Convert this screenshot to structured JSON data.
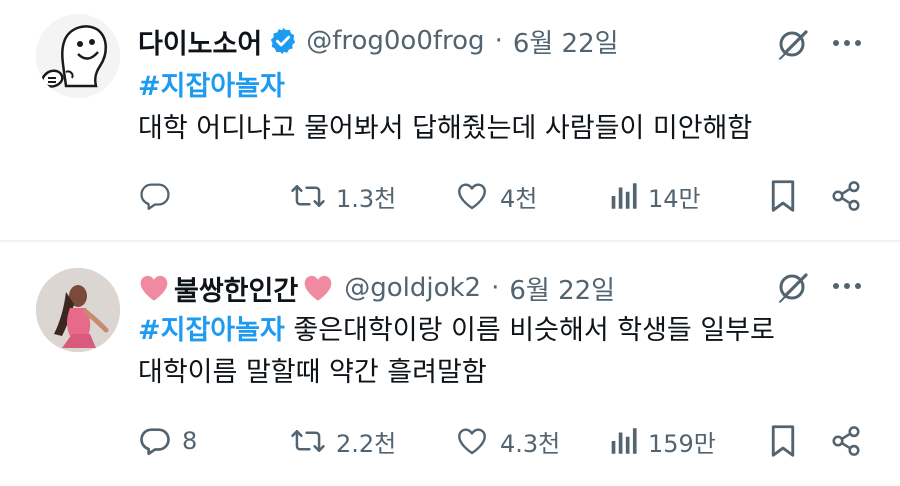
{
  "tweets": [
    {
      "name": "다이노소어",
      "handle": "@frog0o0frog",
      "separator": "·",
      "date": "6월 22일",
      "verified": true,
      "hashtag": "#지잡아놀자",
      "text_inline": "",
      "lines": [
        "대학 어디냐고 물어봐서 답해줬는데 사람들이 미안해함"
      ],
      "stats": {
        "replies": "",
        "retweets": "1.3천",
        "likes": "4천",
        "views": "14만"
      },
      "icons": {
        "avatar": "cartoon-avatar",
        "badge": "verified-badge-icon",
        "grok": "grok-icon",
        "more": "more-icon"
      }
    },
    {
      "name": "불쌍한인간",
      "handle": "@goldjok2",
      "separator": "·",
      "date": "6월 22일",
      "verified": false,
      "hashtag": "#지잡아놀자",
      "text_inline": " 좋은대학이랑 이름 비슷해서 학생들 일부로",
      "lines": [
        "대학이름 말할때 약간 흘려말함"
      ],
      "stats": {
        "replies": "8",
        "retweets": "2.2천",
        "likes": "4.3천",
        "views": "159만"
      },
      "icons": {
        "avatar": "photo-avatar",
        "name_decoration": "pink-heart-icon",
        "grok": "grok-icon",
        "more": "more-icon"
      }
    }
  ],
  "colors": {
    "text": "#0f1419",
    "secondary": "#536471",
    "hashtag": "#1d9bf0",
    "divider": "#eff3f4",
    "heart": "#f08aa0"
  }
}
